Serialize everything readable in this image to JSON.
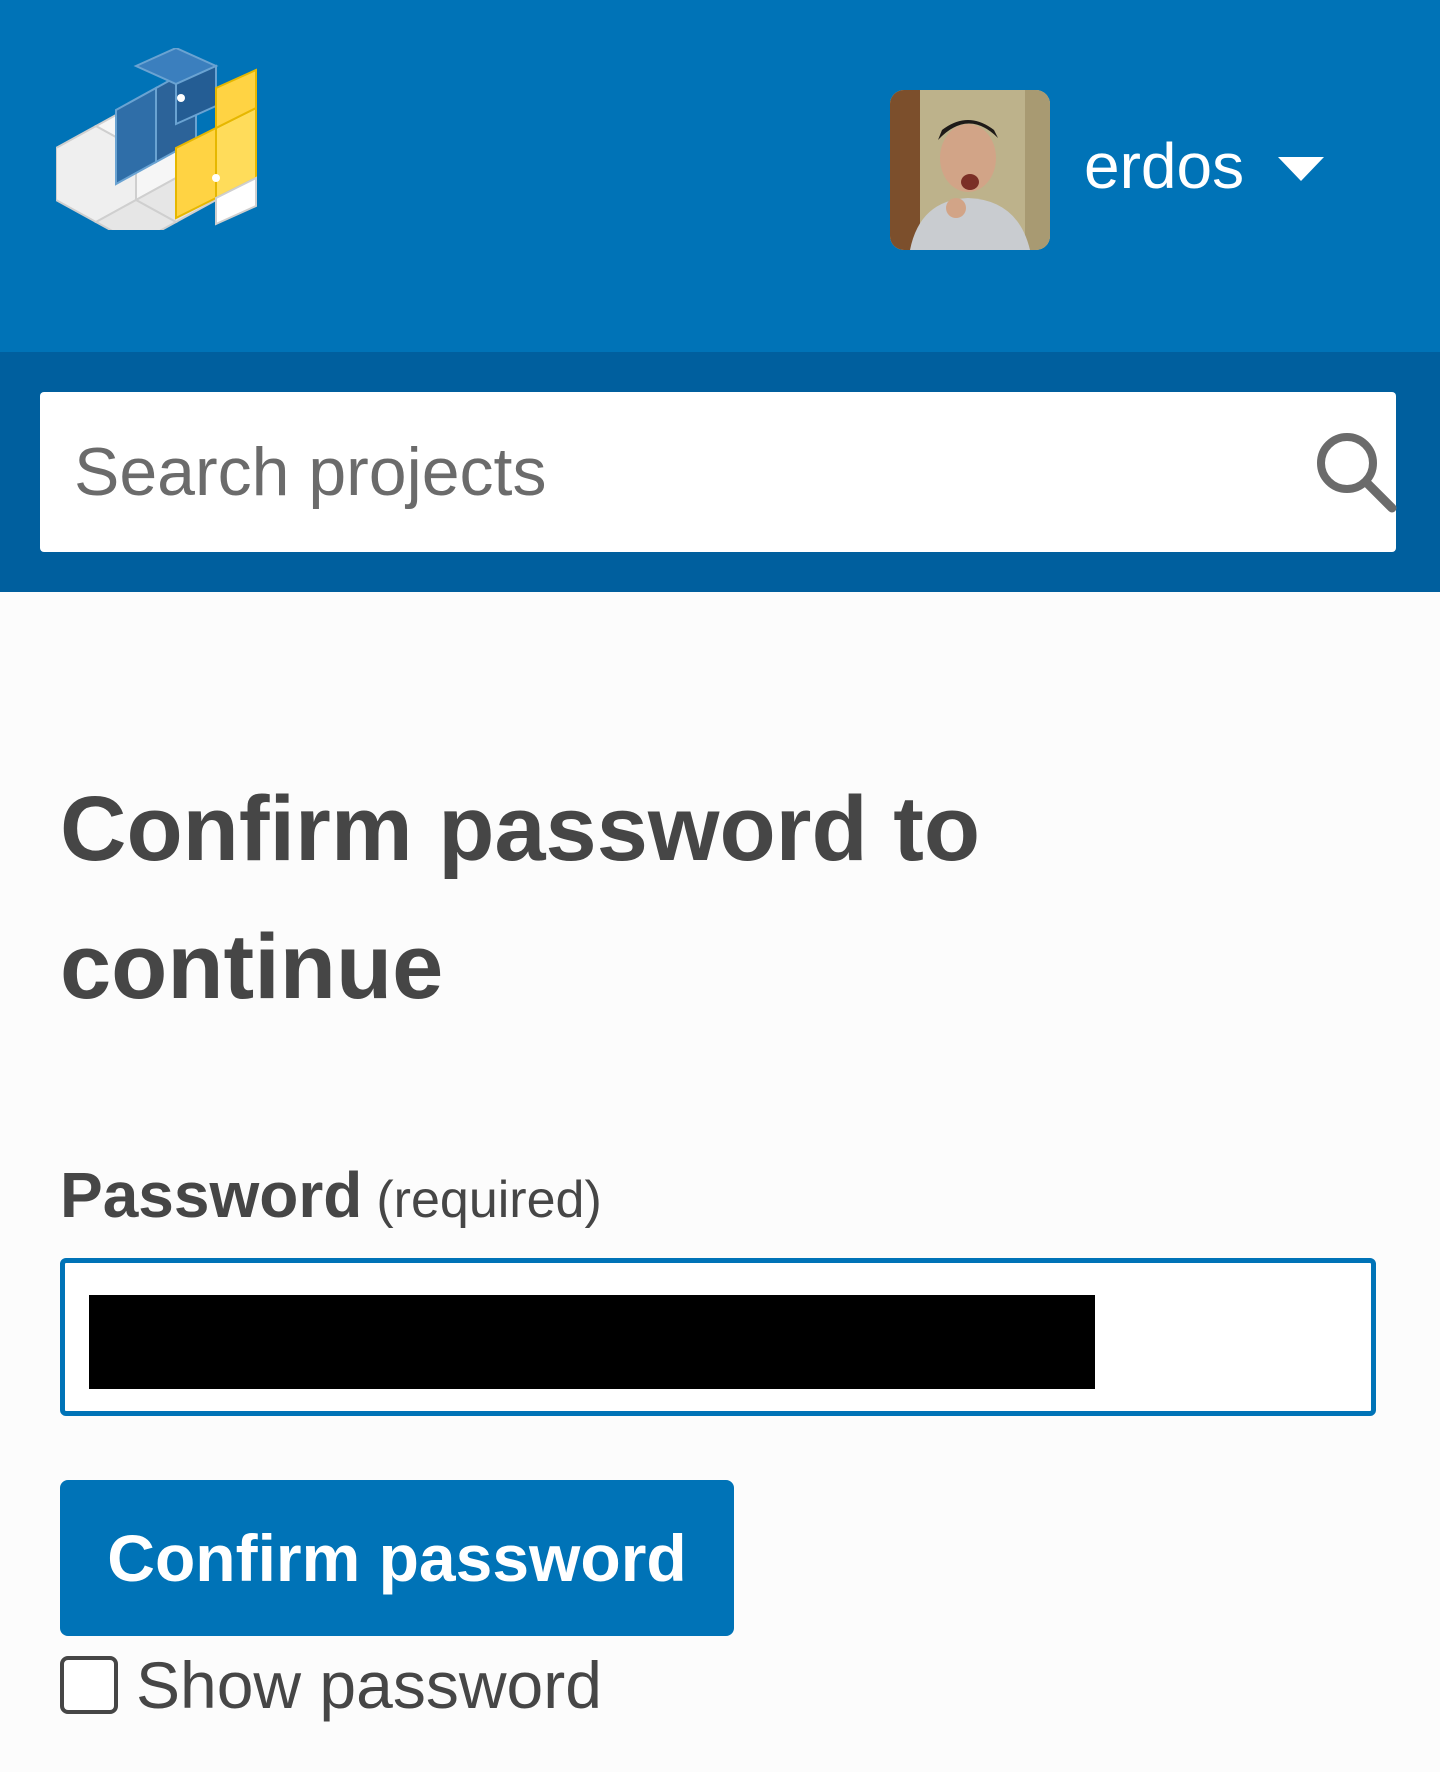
{
  "header": {
    "logo_icon": "pypi-cubes-logo",
    "avatar_icon": "user-avatar-photo",
    "username": "erdos",
    "dropdown_icon": "caret-down-icon"
  },
  "search": {
    "placeholder": "Search projects",
    "icon": "search-icon"
  },
  "main": {
    "title": "Confirm password to continue",
    "password_label": "Password",
    "password_required": "(required)",
    "confirm_button": "Confirm password",
    "show_password_label": "Show password",
    "show_password_checked": false
  },
  "colors": {
    "brand_blue": "#0073b7",
    "search_bar_blue": "#005f9e",
    "text": "#464646",
    "logo_yellow": "#ffd343"
  }
}
